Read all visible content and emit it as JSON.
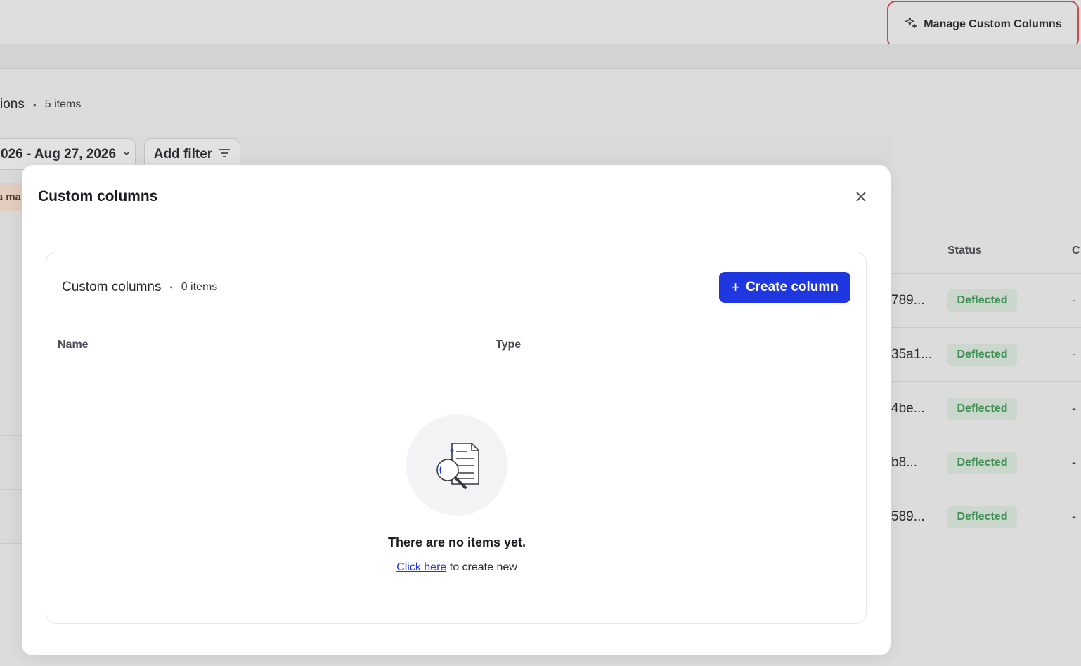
{
  "topbar": {
    "manage_label": "Manage Custom Columns"
  },
  "background": {
    "title": "ions",
    "separator": "•",
    "count": "5 items",
    "date_range": "026 - Aug 27, 2026",
    "add_filter_label": "Add filter",
    "tag_chip": "a ma",
    "status_header": "Status",
    "next_header": "C",
    "rows": [
      {
        "id": "789...",
        "status": "Deflected",
        "extra": "-"
      },
      {
        "id": "35a1...",
        "status": "Deflected",
        "extra": "-"
      },
      {
        "id": "4be...",
        "status": "Deflected",
        "extra": "-"
      },
      {
        "id": "b8...",
        "status": "Deflected",
        "extra": "-"
      },
      {
        "id": "589...",
        "status": "Deflected",
        "extra": "-"
      }
    ]
  },
  "modal": {
    "title": "Custom columns",
    "close_icon": "close-icon",
    "card": {
      "title": "Custom columns",
      "separator": "•",
      "count": "0 items",
      "create_label": "Create column",
      "columns": {
        "name": "Name",
        "type": "Type"
      }
    },
    "empty": {
      "icon": "document-search-icon",
      "title": "There are no items yet.",
      "link_text": "Click here",
      "suffix": " to create new"
    }
  },
  "colors": {
    "primary": "#1f37e0",
    "highlight_border": "#cc4a4a",
    "status_text": "#3f8f55"
  }
}
